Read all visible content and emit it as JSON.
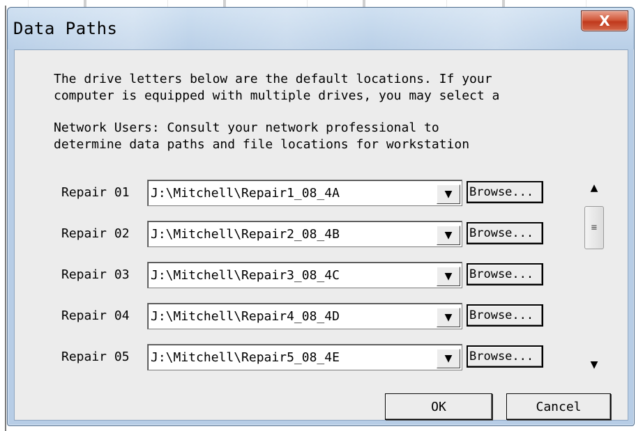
{
  "window": {
    "title": "Data Paths",
    "close_label": "X"
  },
  "description": {
    "paragraph1": "The drive letters below are the default locations. If your\ncomputer is equipped with multiple drives, you may select a\nlocation for each data item.",
    "paragraph2": "Network Users: Consult your network professional to\ndetermine data paths and file locations for workstation\ninstallations."
  },
  "paths": [
    {
      "label": "Repair 01",
      "value": "J:\\Mitchell\\Repair1_08_4A",
      "browse": "Browse..."
    },
    {
      "label": "Repair 02",
      "value": "J:\\Mitchell\\Repair2_08_4B",
      "browse": "Browse..."
    },
    {
      "label": "Repair 03",
      "value": "J:\\Mitchell\\Repair3_08_4C",
      "browse": "Browse..."
    },
    {
      "label": "Repair 04",
      "value": "J:\\Mitchell\\Repair4_08_4D",
      "browse": "Browse..."
    },
    {
      "label": "Repair 05",
      "value": "J:\\Mitchell\\Repair5_08_4E",
      "browse": "Browse..."
    }
  ],
  "icons": {
    "dropdown": "chevron-down-icon",
    "scroll_up": "arrow-up-icon",
    "scroll_down": "arrow-down-icon",
    "scroll_grip": "grip-icon"
  },
  "buttons": {
    "ok": "OK",
    "cancel": "Cancel"
  },
  "colors": {
    "title_bar": "#b9cfe7",
    "close_button": "#c0391c",
    "client_bg": "#ececec"
  }
}
